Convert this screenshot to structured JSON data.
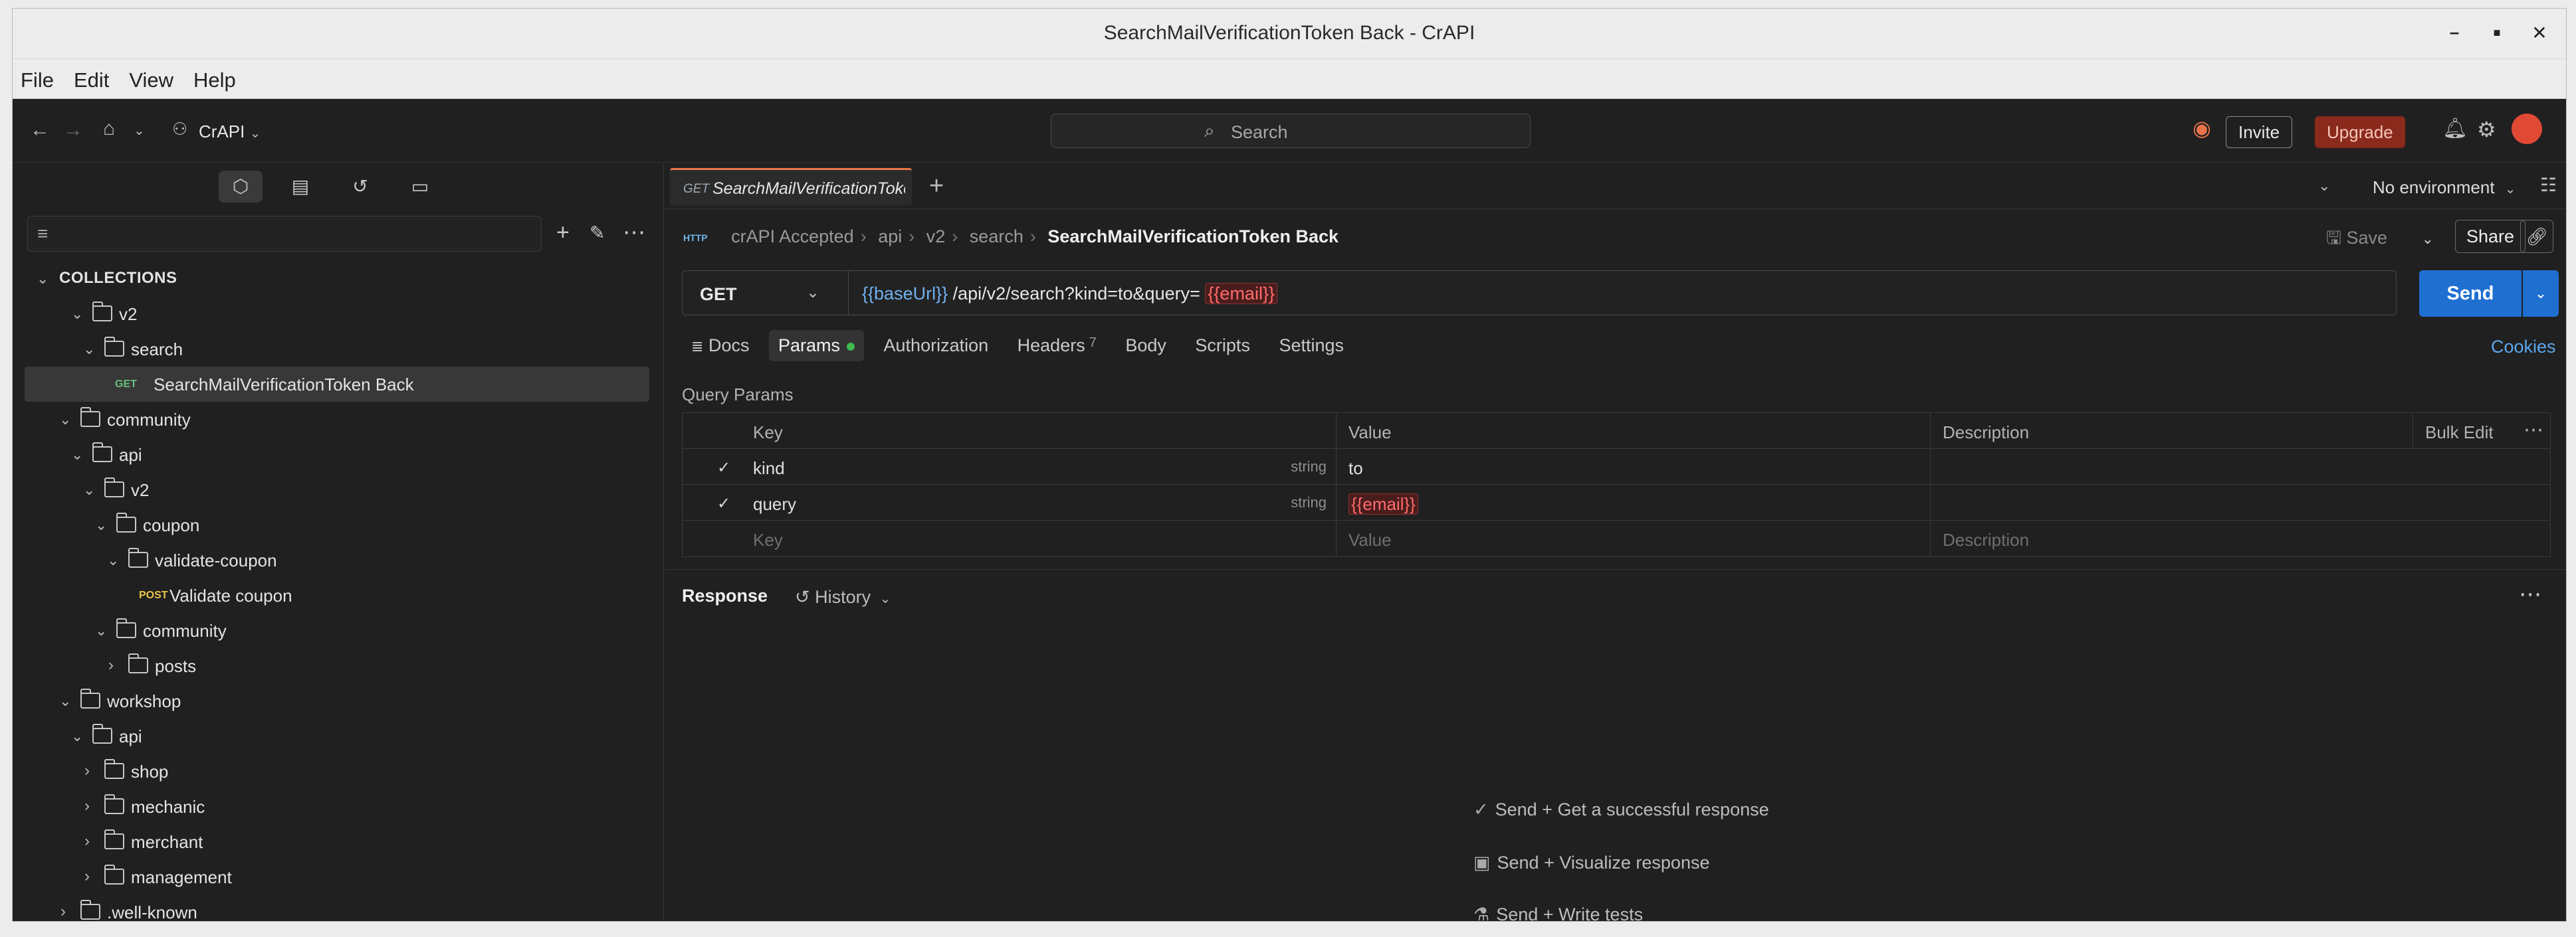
{
  "window": {
    "title": "SearchMailVerificationToken Back - CrAPI"
  },
  "menu": [
    "File",
    "Edit",
    "View",
    "Help"
  ],
  "header": {
    "workspace": "CrAPI",
    "search_placeholder": "Search",
    "invite": "Invite",
    "upgrade": "Upgrade"
  },
  "sidebar": {
    "filter_placeholder": "",
    "collections_label": "COLLECTIONS",
    "tree": [
      {
        "label": "v2",
        "kind": "folder",
        "depth": 1,
        "open": true
      },
      {
        "label": "search",
        "kind": "folder",
        "depth": 2,
        "open": true
      },
      {
        "label": "SearchMailVerificationToken Back",
        "kind": "request",
        "method": "GET",
        "depth": 3,
        "selected": true
      },
      {
        "label": "community",
        "kind": "folder",
        "depth": 0,
        "open": true
      },
      {
        "label": "api",
        "kind": "folder",
        "depth": 1,
        "open": true
      },
      {
        "label": "v2",
        "kind": "folder",
        "depth": 2,
        "open": true
      },
      {
        "label": "coupon",
        "kind": "folder",
        "depth": 3,
        "open": true
      },
      {
        "label": "validate-coupon",
        "kind": "folder",
        "depth": 4,
        "open": true
      },
      {
        "label": "Validate coupon",
        "kind": "request",
        "method": "POST",
        "depth": 5
      },
      {
        "label": "community",
        "kind": "folder",
        "depth": 3,
        "open": true
      },
      {
        "label": "posts",
        "kind": "folder",
        "depth": 4,
        "open": false
      },
      {
        "label": "workshop",
        "kind": "folder",
        "depth": 0,
        "open": true
      },
      {
        "label": "api",
        "kind": "folder",
        "depth": 1,
        "open": true
      },
      {
        "label": "shop",
        "kind": "folder",
        "depth": 2,
        "open": false
      },
      {
        "label": "mechanic",
        "kind": "folder",
        "depth": 2,
        "open": false
      },
      {
        "label": "merchant",
        "kind": "folder",
        "depth": 2,
        "open": false
      },
      {
        "label": "management",
        "kind": "folder",
        "depth": 2,
        "open": false
      },
      {
        "label": ".well-known",
        "kind": "folder",
        "depth": 0,
        "open": false
      }
    ]
  },
  "tab": {
    "method": "GET",
    "name": "SearchMailVerificationToke"
  },
  "environment": "No environment",
  "breadcrumb": {
    "badge": "HTTP",
    "parts": [
      "crAPI Accepted",
      "api",
      "v2",
      "search"
    ],
    "current": "SearchMailVerificationToken Back"
  },
  "actions": {
    "save": "Save",
    "share": "Share"
  },
  "request": {
    "method": "GET",
    "url_var": "{{baseUrl}}",
    "url_path": "/api/v2/search?kind=to&query=",
    "url_var2": "{{email}}",
    "send": "Send"
  },
  "req_tabs": {
    "docs": "Docs",
    "params": "Params",
    "authorization": "Authorization",
    "headers": "Headers",
    "headers_count": "7",
    "body": "Body",
    "scripts": "Scripts",
    "settings": "Settings",
    "cookies": "Cookies"
  },
  "params": {
    "title": "Query Params",
    "columns": {
      "key": "Key",
      "value": "Value",
      "description": "Description",
      "bulk": "Bulk Edit"
    },
    "rows": [
      {
        "key": "kind",
        "type": "string",
        "value": "to",
        "checked": true
      },
      {
        "key": "query",
        "type": "string",
        "value": "{{email}}",
        "checked": true
      }
    ],
    "placeholder": {
      "key": "Key",
      "value": "Value",
      "description": "Description"
    }
  },
  "response": {
    "title": "Response",
    "history": "History",
    "hints": [
      "Send + Get a successful response",
      "Send + Visualize response",
      "Send + Write tests"
    ]
  }
}
